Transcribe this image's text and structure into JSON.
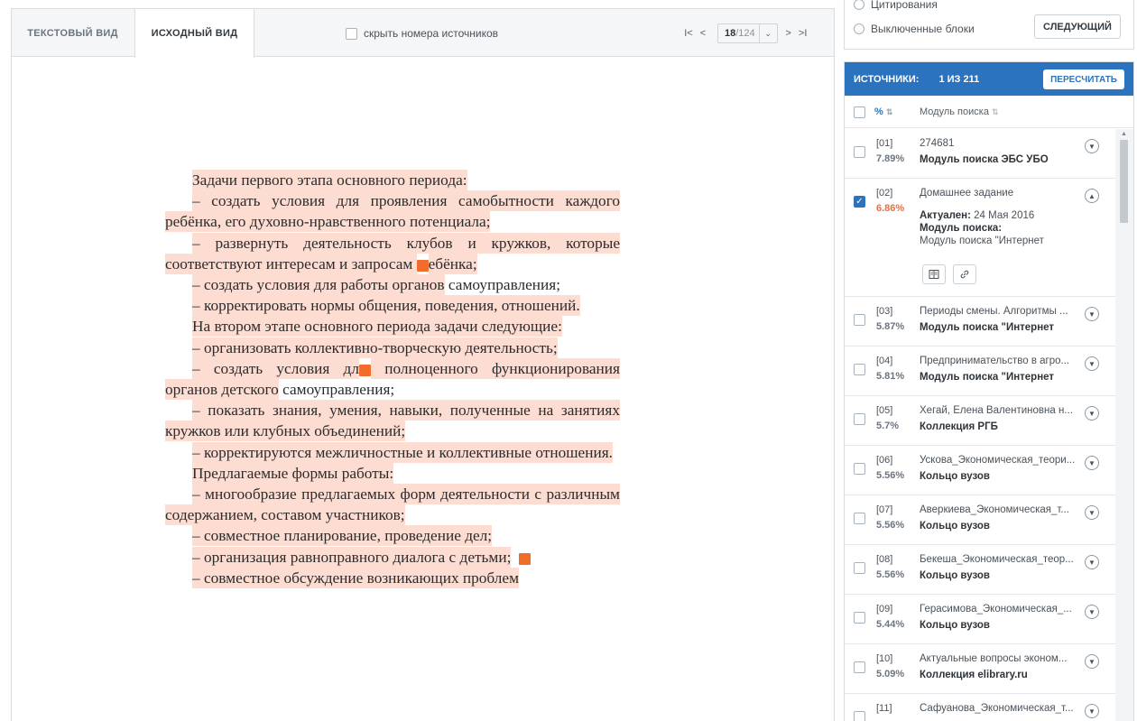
{
  "viewer": {
    "tabs": [
      {
        "label": "ТЕКСТОВЫЙ ВИД",
        "active": false
      },
      {
        "label": "ИСХОДНЫЙ ВИД",
        "active": true
      }
    ],
    "hide_numbers_label": "скрыть номера источников",
    "pager": {
      "first": "I<",
      "prev": "<",
      "current": "18",
      "total": "/124",
      "next": ">",
      "last": ">I"
    }
  },
  "document": {
    "lines": {
      "l1": "Задачи первого этапа основного периода:",
      "l2": "– создать условия для проявления самобытности каждого ребёнка, его духовно-нравственного потенциала;",
      "l3": "– развернуть деятельность клубов и кружков, которые соответствуют интересам и запросам ",
      "l3b": "ебёнка;",
      "l4a": "– создать условия для работы органов",
      "l4b": " самоуправления;",
      "l5": "– корректировать нормы общения, поведения, отношений.",
      "l6": "На втором этапе основного периода задачи следующие:",
      "l7": "– организовать коллективно-творческую деятельность;",
      "l8a": "– создать условия дл",
      "l8b": " полноценного функционирования органов детского",
      "l8c": " самоуправления;",
      "l9": "– показать знания, умения, навыки, полученные на занятиях кружков или клубных объединений;",
      "l10": "– корректируются межличностные и коллективные отношения.",
      "l11": "Предлагаемые формы работы:",
      "l12": "– многообразие предлагаемых форм деятельности с различным содержанием, составом участников;",
      "l13": "– совместное планирование, проведение дел;",
      "l14": "– организация равноправного диалога с детьми;",
      "l15": "– совместное обсуждение возникающих проблем"
    },
    "marker": "2"
  },
  "options": {
    "radio_citations": "Цитирования",
    "radio_excluded": "Выключенные блоки",
    "next_button": "СЛЕДУЮЩИЙ"
  },
  "sources": {
    "title": "ИСТОЧНИКИ:",
    "count": "1 ИЗ 211",
    "recalc_button": "ПЕРЕСЧИТАТЬ",
    "col_percent": "%",
    "col_module": "Модуль поиска",
    "items": [
      {
        "num": "[01]",
        "percent": "7.89%",
        "title": "274681",
        "module": "Модуль поиска ЭБС УБО"
      },
      {
        "num": "[02]",
        "percent": "6.86%",
        "title": "Домашнее задание",
        "actual_label": "Актуален:",
        "actual_date": "24 Мая 2016",
        "module_label": "Модуль поиска:",
        "module_value": "Модуль поиска \"Интернет"
      },
      {
        "num": "[03]",
        "percent": "5.87%",
        "title": "Периоды смены. Алгоритмы ...",
        "module": "Модуль поиска \"Интернет"
      },
      {
        "num": "[04]",
        "percent": "5.81%",
        "title": "Предпринимательство в агро...",
        "module": "Модуль поиска \"Интернет"
      },
      {
        "num": "[05]",
        "percent": "5.7%",
        "title": "Хегай, Елена Валентиновна н...",
        "module": "Коллекция РГБ"
      },
      {
        "num": "[06]",
        "percent": "5.56%",
        "title": "Ускова_Экономическая_теори...",
        "module": "Кольцо вузов"
      },
      {
        "num": "[07]",
        "percent": "5.56%",
        "title": "Аверкиева_Экономическая_т...",
        "module": "Кольцо вузов"
      },
      {
        "num": "[08]",
        "percent": "5.56%",
        "title": "Бекеша_Экономическая_теор...",
        "module": "Кольцо вузов"
      },
      {
        "num": "[09]",
        "percent": "5.44%",
        "title": "Герасимова_Экономическая_...",
        "module": "Кольцо вузов"
      },
      {
        "num": "[10]",
        "percent": "5.09%",
        "title": "Актуальные вопросы эконом...",
        "module": "Коллекция elibrary.ru"
      },
      {
        "num": "[11]",
        "percent": "",
        "title": "Сафуанова_Экономическая_т...",
        "module": ""
      }
    ]
  },
  "colors": {
    "accent": "#2b73bf",
    "highlight": "#fddcd2",
    "marker": "#f26c2b",
    "percent_red": "#ef6c3e"
  }
}
